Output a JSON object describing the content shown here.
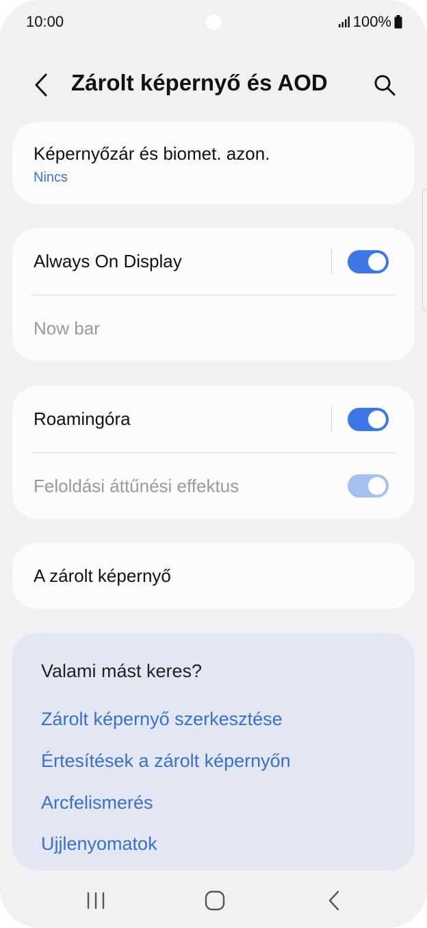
{
  "status_bar": {
    "time": "10:00",
    "battery": "100%",
    "icons": [
      "signal-icon",
      "battery-icon"
    ]
  },
  "header": {
    "title": "Zárolt képernyő és AOD",
    "icons": [
      "back-arrow-icon",
      "search-icon"
    ]
  },
  "settings": {
    "lock_card": {
      "title": "Képernyőzár és biomet. azon.",
      "value": "Nincs"
    },
    "aod_card": {
      "always_on": {
        "label": "Always On Display",
        "enabled": true
      },
      "now_bar": {
        "label": "Now bar",
        "disabled": true
      }
    },
    "roaming_card": {
      "roaming_clock": {
        "label": "Roamingóra",
        "enabled": true
      },
      "unlock_effect": {
        "label": "Feloldási áttűnési effektus",
        "enabled": true,
        "disabled": true
      }
    },
    "locked_screen_card": {
      "label": "A zárolt képernyő"
    }
  },
  "suggestions": {
    "title": "Valami mást keres?",
    "links": [
      "Zárolt képernyő szerkesztése",
      "Értesítések a zárolt képernyőn",
      "Arcfelismerés",
      "Ujjlenyomatok"
    ]
  },
  "nav_bar": {
    "icons": [
      "recent-apps-icon",
      "home-icon",
      "back-icon"
    ]
  },
  "colors": {
    "accent": "#3d77e5",
    "link": "#3a6fcc",
    "background": "#f1f1f3",
    "card": "#fcfcfe",
    "suggest_bg": "#e3e7f3"
  }
}
